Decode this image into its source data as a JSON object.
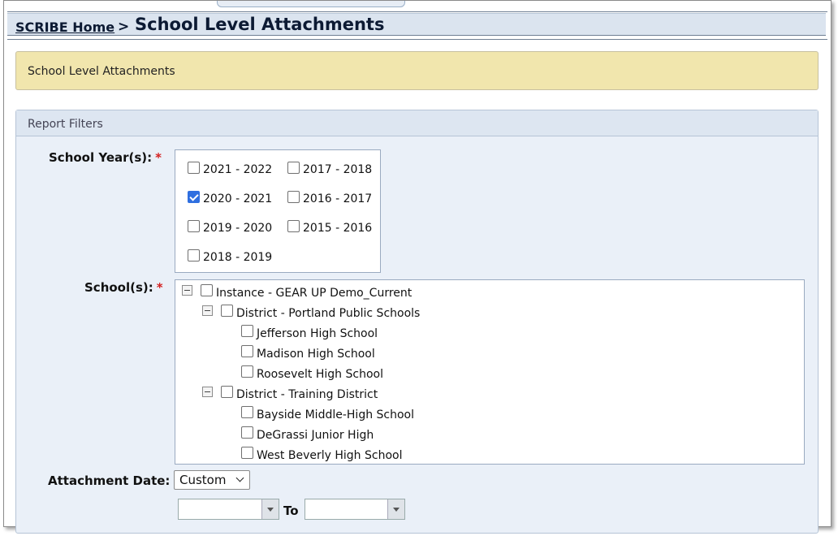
{
  "header": {
    "breadcrumb_home": "SCRIBE Home",
    "separator": ">",
    "title": "School Level Attachments"
  },
  "notice": {
    "text": "School Level Attachments"
  },
  "panel": {
    "title": "Report Filters"
  },
  "school_years": {
    "label": "School Year(s):",
    "required": "*",
    "options": [
      {
        "label": "2021 - 2022",
        "checked": false
      },
      {
        "label": "2017 - 2018",
        "checked": false
      },
      {
        "label": "2020 - 2021",
        "checked": true
      },
      {
        "label": "2016 - 2017",
        "checked": false
      },
      {
        "label": "2019 - 2020",
        "checked": false
      },
      {
        "label": "2015 - 2016",
        "checked": false
      },
      {
        "label": "2018 - 2019",
        "checked": false
      }
    ]
  },
  "schools": {
    "label": "School(s):",
    "required": "*",
    "tree": [
      {
        "label": "Instance - GEAR UP Demo_Current",
        "checked": false,
        "expandable": true
      },
      {
        "label": "District - Portland Public Schools",
        "checked": false,
        "expandable": true
      },
      {
        "label": "Jefferson High School",
        "checked": false
      },
      {
        "label": "Madison High School",
        "checked": false
      },
      {
        "label": "Roosevelt High School",
        "checked": false
      },
      {
        "label": "District - Training District",
        "checked": false,
        "expandable": true
      },
      {
        "label": "Bayside Middle-High School",
        "checked": false
      },
      {
        "label": "DeGrassi Junior High",
        "checked": false
      },
      {
        "label": "West Beverly High School",
        "checked": false
      }
    ]
  },
  "attachment_date": {
    "label": "Attachment Date:",
    "selected": "Custom",
    "from_value": "",
    "to_label": "To",
    "to_value": ""
  }
}
